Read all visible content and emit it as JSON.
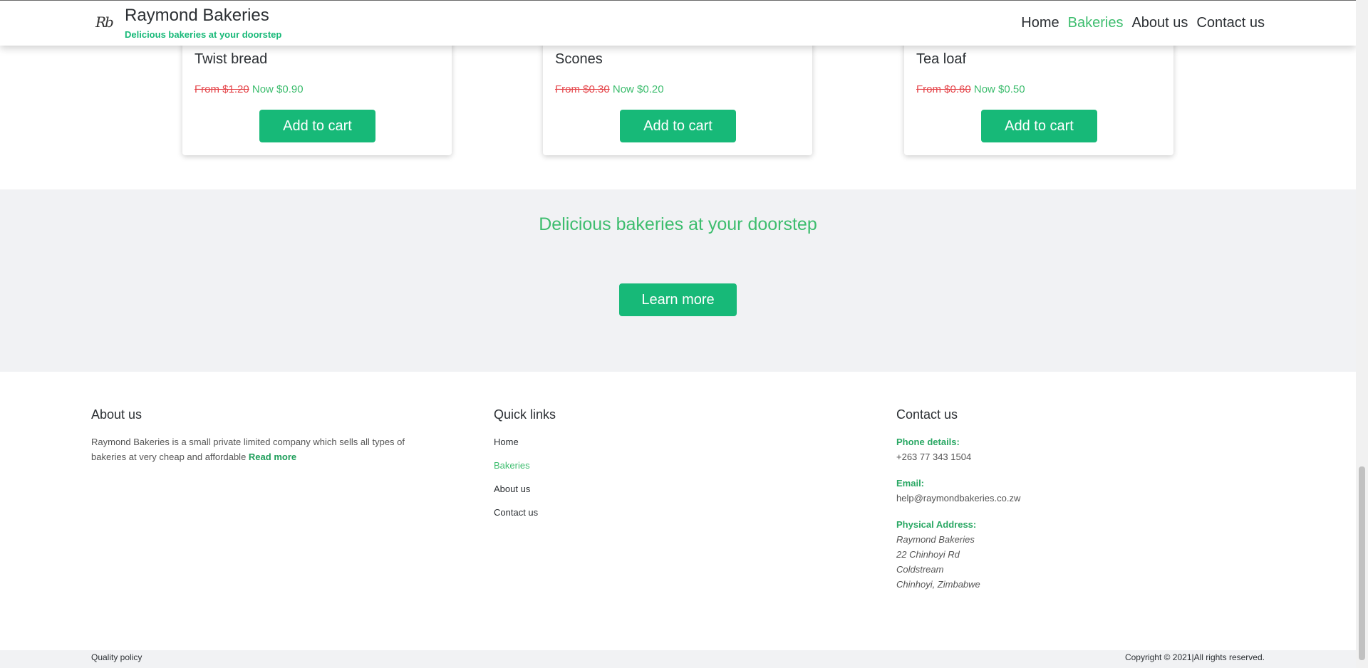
{
  "header": {
    "logo_text": "Rb",
    "brand_name": "Raymond Bakeries",
    "tagline": "Delicious bakeries at your doorstep",
    "nav": [
      {
        "label": "Home",
        "active": false
      },
      {
        "label": "Bakeries",
        "active": true
      },
      {
        "label": "About us",
        "active": false
      },
      {
        "label": "Contact us",
        "active": false
      }
    ]
  },
  "products": [
    {
      "name": "Twist bread",
      "old_price": "From $1.20",
      "new_price": "Now $0.90",
      "button": "Add to cart"
    },
    {
      "name": "Scones",
      "old_price": "From $0.30",
      "new_price": "Now $0.20",
      "button": "Add to cart"
    },
    {
      "name": "Tea loaf",
      "old_price": "From $0.60",
      "new_price": "Now $0.50",
      "button": "Add to cart"
    }
  ],
  "banner": {
    "text": "Delicious bakeries at your doorstep",
    "button": "Learn more"
  },
  "footer": {
    "about": {
      "heading": "About us",
      "text": "Raymond Bakeries is a small private limited company which sells all types of bakeries at very cheap and affordable",
      "read_more": "Read more"
    },
    "quick_links": {
      "heading": "Quick links",
      "links": [
        {
          "label": "Home",
          "active": false
        },
        {
          "label": "Bakeries",
          "active": true
        },
        {
          "label": "About us",
          "active": false
        },
        {
          "label": "Contact us",
          "active": false
        }
      ]
    },
    "contact": {
      "heading": "Contact us",
      "phone_label": "Phone details:",
      "phone": "+263 77 343 1504",
      "email_label": "Email:",
      "email": "help@raymondbakeries.co.zw",
      "address_label": "Physical Address:",
      "address": [
        "Raymond Bakeries",
        "22 Chinhoyi Rd",
        "Coldstream",
        "Chinhoyi, Zimbabwe"
      ]
    }
  },
  "bottom": {
    "left": "Quality policy",
    "right": "Copyright © 2021|All rights reserved."
  },
  "colors": {
    "accent": "#17b978",
    "accent_text": "#3dbd6e",
    "old_price": "#e5484d",
    "banner_bg": "#f1f2f4"
  }
}
